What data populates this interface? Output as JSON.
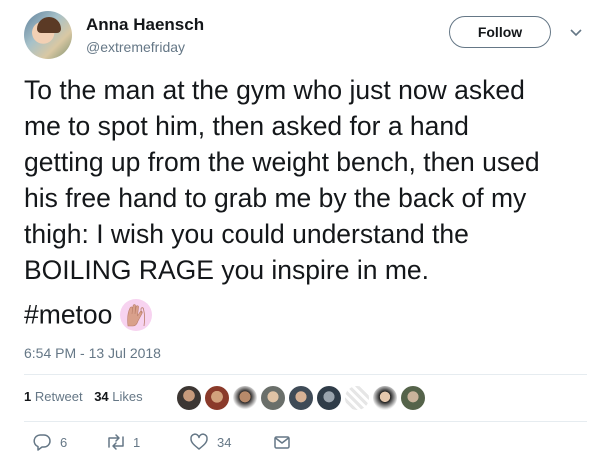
{
  "author": {
    "name": "Anna Haensch",
    "handle": "@extremefriday"
  },
  "follow_label": "Follow",
  "tweet": {
    "lines": [
      "To the man at the gym who just now  asked",
      "me to spot him, then asked for a hand",
      "getting up from the weight bench, then used",
      "his free hand to grab me by the back of my",
      "thigh: I wish you could understand the",
      "BOILING RAGE you inspire in me."
    ],
    "hashtag": "#metoo"
  },
  "timestamp": "6:54 PM - 13 Jul 2018",
  "stats": {
    "retweets_count": "1",
    "retweets_label": "Retweet",
    "likes_count": "34",
    "likes_label": "Likes"
  },
  "actions": {
    "reply_count": "6",
    "retweet_count": "1",
    "like_count": "34"
  },
  "colors": {
    "text": "#14171a",
    "muted": "#657786",
    "divider": "#e6ecf0",
    "emoji_bg": "#f7d3f0"
  }
}
